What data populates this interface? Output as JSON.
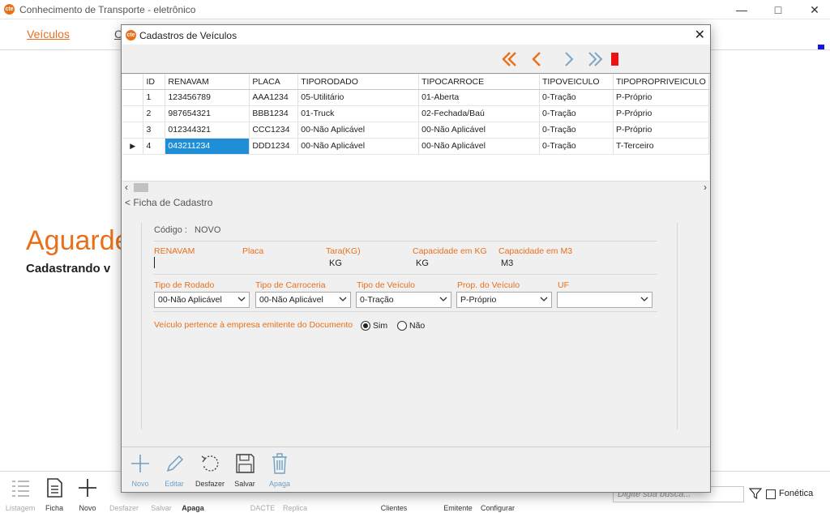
{
  "app": {
    "title": "Conhecimento de Transporte - eletrônico",
    "icon_text": "cte",
    "menu": [
      "Veículos",
      "C"
    ],
    "wait_title": "Aguarde",
    "wait_sub": "Cadastrando v"
  },
  "bottom_toolbar": {
    "items": [
      {
        "label": "Listagem",
        "icon": "list-icon",
        "enabled": false
      },
      {
        "label": "Ficha",
        "icon": "document-icon",
        "enabled": true
      },
      {
        "label": "Novo",
        "icon": "plus-icon",
        "enabled": true
      },
      {
        "label": "Desfazer",
        "icon": "undo-icon",
        "enabled": false
      },
      {
        "label": "Salvar",
        "icon": "save-icon",
        "enabled": false
      },
      {
        "label": "Apaga",
        "icon": "trash-icon",
        "enabled": true
      },
      {
        "label": "DACTE",
        "icon": "print-icon",
        "enabled": false
      },
      {
        "label": "Replica",
        "icon": "copy-icon",
        "enabled": false
      },
      {
        "label": "Clientes",
        "icon": "clients-icon",
        "enabled": true
      },
      {
        "label": "Emitente",
        "icon": "building-icon",
        "enabled": true
      },
      {
        "label": "Configurar",
        "icon": "gear-icon",
        "enabled": true
      }
    ],
    "search_placeholder": "Digite sua busca...",
    "fonetica_label": "Fonética"
  },
  "dialog": {
    "title": "Cadastros de Veículos",
    "colors": {
      "accent": "#e8701a",
      "nav_inactive": "#7ea6c4",
      "selection": "#1e8fd6",
      "stop": "#ee1111"
    },
    "grid": {
      "columns": [
        "ID",
        "RENAVAM",
        "PLACA",
        "TIPORODADO",
        "TIPOCARROCE",
        "TIPOVEICULO",
        "TIPOPROPRIVEICULO"
      ],
      "rows": [
        [
          "1",
          "123456789",
          "AAA1234",
          "05-Utilitário",
          "01-Aberta",
          "0-Tração",
          "P-Próprio"
        ],
        [
          "2",
          "987654321",
          "BBB1234",
          "01-Truck",
          "02-Fechada/Baú",
          "0-Tração",
          "P-Próprio"
        ],
        [
          "3",
          "012344321",
          "CCC1234",
          "00-Não Aplicável",
          "00-Não Aplicável",
          "0-Tração",
          "P-Próprio"
        ],
        [
          "4",
          "043211234",
          "DDD1234",
          "00-Não Aplicável",
          "00-Não Aplicável",
          "0-Tração",
          "T-Terceiro"
        ]
      ],
      "current_row": 4
    },
    "ficha": {
      "header": "< Ficha de Cadastro",
      "codigo_label": "Código :",
      "codigo_value": "NOVO",
      "renavam_label": "RENAVAM",
      "placa_label": "Placa",
      "tara_label": "Tara(KG)",
      "tara_unit": "KG",
      "capkg_label": "Capacidade em KG",
      "capkg_unit": "KG",
      "capm3_label": "Capacidade em M3",
      "capm3_unit": "M3",
      "rodado_label": "Tipo de Rodado",
      "rodado_value": "00-Não Aplicável",
      "carroceria_label": "Tipo de Carroceria",
      "carroceria_value": "00-Não Aplicável",
      "veiculo_label": "Tipo de Veículo",
      "veiculo_value": "0-Tração",
      "prop_label": "Prop. do Veículo",
      "prop_value": "P-Próprio",
      "uf_label": "UF",
      "uf_value": "",
      "pertence_label": "Veículo pertence à empresa emitente do Documento",
      "sim_label": "Sim",
      "nao_label": "Não",
      "pertence_value": "Sim"
    },
    "toolbar": {
      "novo": "Novo",
      "editar": "Editar",
      "desfazer": "Desfazer",
      "salvar": "Salvar",
      "apaga": "Apaga"
    }
  }
}
